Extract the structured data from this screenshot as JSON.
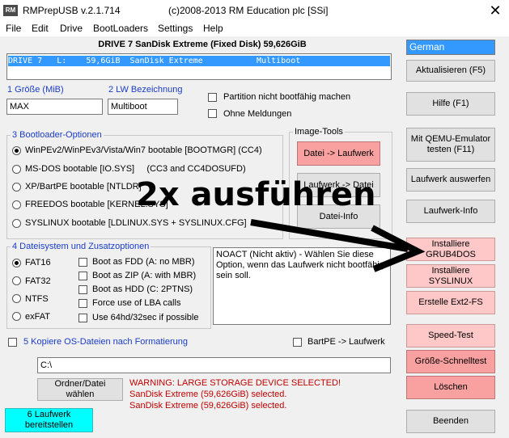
{
  "window": {
    "app_title": "RMPrepUSB v.2.1.714",
    "title_right": "(c)2008-2013 RM Education plc [SSi]",
    "icon_text": "RM",
    "close_glyph": "✕"
  },
  "menu": [
    "File",
    "Edit",
    "Drive",
    "BootLoaders",
    "Settings",
    "Help"
  ],
  "drive": {
    "header": "DRIVE 7 SanDisk Extreme  (Fixed Disk) 59,626GiB",
    "row": "DRIVE 7   L:    59,6GiB  SanDisk Extreme           Multiboot"
  },
  "language": {
    "selected": "German"
  },
  "step1": {
    "label": "1 Größe (MiB)",
    "value": "MAX"
  },
  "step2": {
    "label": "2 LW Bezeichnung",
    "value": "Multiboot"
  },
  "checks_top": [
    {
      "label": "Partition nicht bootfähig machen",
      "checked": false
    },
    {
      "label": "Ohne Meldungen",
      "checked": false
    }
  ],
  "bootloader_group": {
    "legend": "3 Bootloader-Optionen",
    "options": [
      {
        "label": "WinPEv2/WinPEv3/Vista/Win7 bootable [BOOTMGR] (CC4)",
        "checked": true
      },
      {
        "label": "MS-DOS bootable [IO.SYS]     (CC3 and CC4DOSUFD)",
        "checked": false
      },
      {
        "label": "XP/BartPE bootable [NTLDR]",
        "checked": false
      },
      {
        "label": "FREEDOS bootable [KERNEL.SYS]",
        "checked": false
      },
      {
        "label": "SYSLINUX bootable [LDLINUX.SYS + SYSLINUX.CFG]",
        "checked": false
      }
    ]
  },
  "image_tools": {
    "legend": "Image-Tools",
    "btn_file_to_drive": "Datei -> Laufwerk",
    "btn_drive_to_file": "Laufwerk -> Datei",
    "btn_file_info": "Datei-Info"
  },
  "fs_group": {
    "legend": "4 Dateisystem und Zusatzoptionen",
    "fs": [
      {
        "label": "FAT16",
        "checked": true
      },
      {
        "label": "FAT32",
        "checked": false
      },
      {
        "label": "NTFS",
        "checked": false
      },
      {
        "label": "exFAT",
        "checked": false
      }
    ],
    "extras": [
      {
        "label": "Boot as FDD (A: no MBR)",
        "checked": false
      },
      {
        "label": "Boot as ZIP (A: with MBR)",
        "checked": false
      },
      {
        "label": "Boot as HDD (C: 2PTNS)",
        "checked": false
      },
      {
        "label": "Force use of LBA calls",
        "checked": false
      },
      {
        "label": "Use 64hd/32sec if possible",
        "checked": false
      }
    ]
  },
  "note": "NOACT (Nicht aktiv) - Wählen Sie diese Option, wenn das Laufwerk nicht bootfähig sein soll.",
  "step5": {
    "label": "5 Kopiere OS-Dateien nach Formatierung",
    "checked": false
  },
  "bartpe": {
    "label": "BartPE -> Laufwerk",
    "checked": false
  },
  "path_value": "C:\\",
  "btn_choose_folder": "Ordner/Datei wählen",
  "warning_lines": [
    "WARNING: LARGE STORAGE DEVICE SELECTED!",
    "SanDisk Extreme (59,626GiB) selected.",
    "SanDisk Extreme (59,626GiB) selected."
  ],
  "btn_prepare": "6 Laufwerk bereitstellen",
  "right_buttons": {
    "refresh": "Aktualisieren (F5)",
    "help": "Hilfe (F1)",
    "qemu": "Mit QEMU-Emulator testen (F11)",
    "eject": "Laufwerk auswerfen",
    "drive_info": "Laufwerk-Info",
    "grub4dos": "Installiere GRUB4DOS",
    "syslinux": "Installiere SYSLINUX",
    "ext2fs": "Erstelle Ext2-FS",
    "speedtest": "Speed-Test",
    "quicksize": "Größe-Schnelltest",
    "delete": "Löschen",
    "exit": "Beenden"
  },
  "annotation": {
    "text": "2x ausführen",
    "color": "#000000"
  },
  "colors": {
    "selection": "#3399ff",
    "red_button": "#f9a0a0",
    "pink_button": "#ffc8c8",
    "cyan_button": "#00ffff",
    "warning": "#c00000",
    "label_blue": "#1a3cc8"
  }
}
